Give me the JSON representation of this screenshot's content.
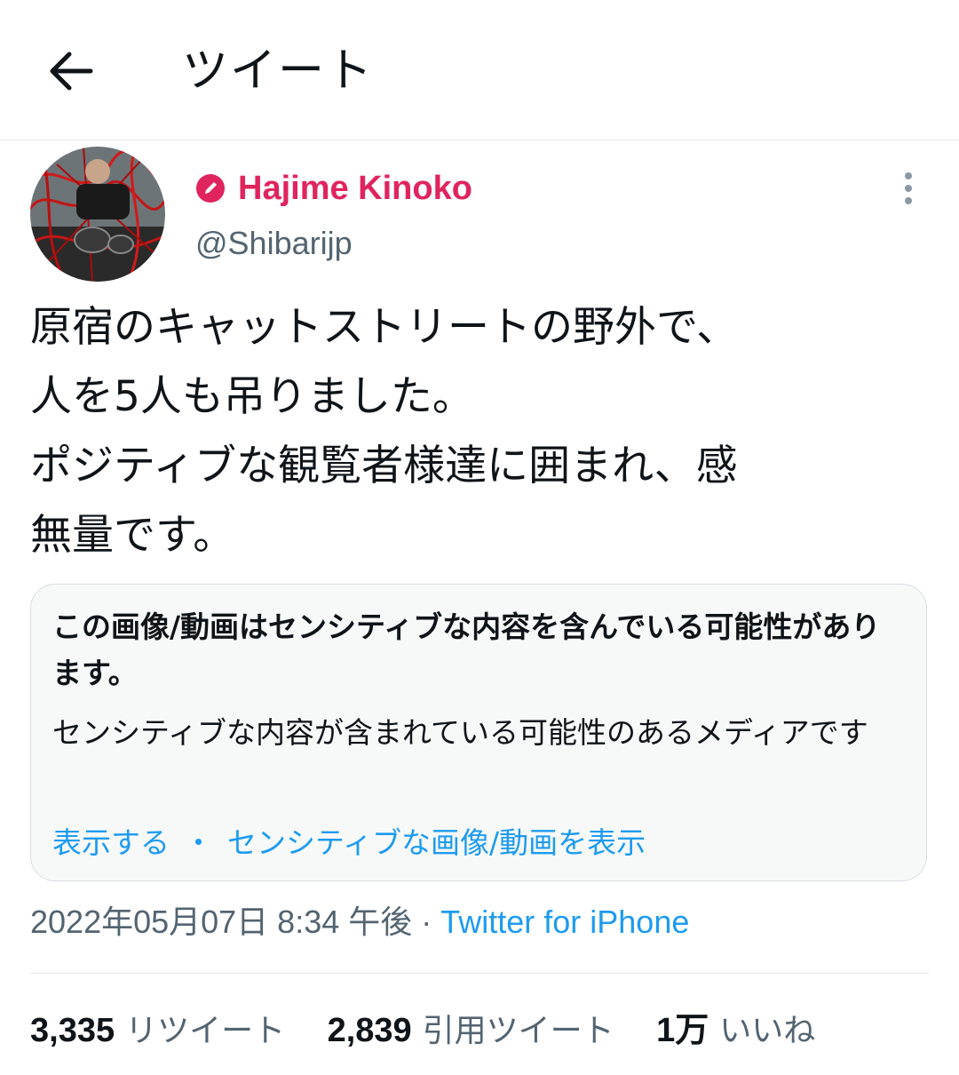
{
  "header": {
    "title": "ツイート",
    "back_icon": "arrow-left-icon"
  },
  "author": {
    "display_name": "Hajime Kinoko",
    "handle": "@Shibarijp",
    "name_color": "#e0245e",
    "badge_icon": "pencil-circle-icon"
  },
  "tweet": {
    "text": "原宿のキャットストリートの野外で、\n人を5人も吊りました。\nポジティブな観覧者様達に囲まれ、感\n無量です。"
  },
  "sensitive": {
    "title": "この画像/動画はセンシティブな内容を含んでいる可能性があります。",
    "description": "センシティブな内容が含まれている可能性のあるメディアです",
    "show_link": "表示する",
    "separator": "・",
    "settings_link": "センシティブな画像/動画を表示"
  },
  "meta": {
    "timestamp": "2022年05月07日 8:34 午後",
    "dot": " · ",
    "source": "Twitter for iPhone"
  },
  "stats": {
    "retweets": {
      "count": "3,335",
      "label": "リツイート"
    },
    "quotes": {
      "count": "2,839",
      "label": "引用ツイート"
    },
    "likes": {
      "count": "1万",
      "label": "いいね"
    }
  },
  "colors": {
    "link": "#1d9bf0",
    "secondary": "#536471",
    "accent_name": "#e0245e"
  }
}
